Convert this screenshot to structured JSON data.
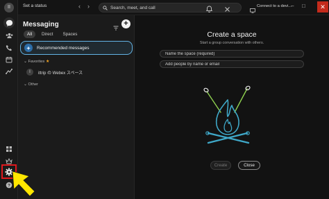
{
  "topbar": {
    "status": "Set a status",
    "search_placeholder": "Search, meet, and call",
    "connect_label": "Connect to a devi...",
    "back_arrow": "‹",
    "forward_arrow": "›"
  },
  "rail": {
    "avatar_initial": "II",
    "icons": [
      "messaging-icon",
      "teams-icon",
      "calling-icon",
      "calendar-icon",
      "activity-icon",
      "apps-icon",
      "premium-icon",
      "settings-icon",
      "help-icon"
    ]
  },
  "messaging": {
    "title": "Messaging",
    "tabs": [
      "All",
      "Direct",
      "Spaces"
    ],
    "recommended_label": "Recommended messages",
    "favorites_label": "Favorites",
    "favorite_item_initial": "I",
    "favorite_item_label": "ittrip の Webex スペース",
    "other_label": "Other"
  },
  "create_space": {
    "title": "Create a space",
    "subtitle": "Start a group conversation with others.",
    "name_placeholder": "Name the space (required)",
    "people_placeholder": "Add people by name or email",
    "create_label": "Create",
    "close_label": "Close"
  },
  "colors": {
    "accent": "#64b4e6",
    "highlight_box": "#e0191e",
    "arrow": "#ffe600",
    "illustration_blue": "#3fa8c8",
    "illustration_green": "#8fd14f"
  }
}
